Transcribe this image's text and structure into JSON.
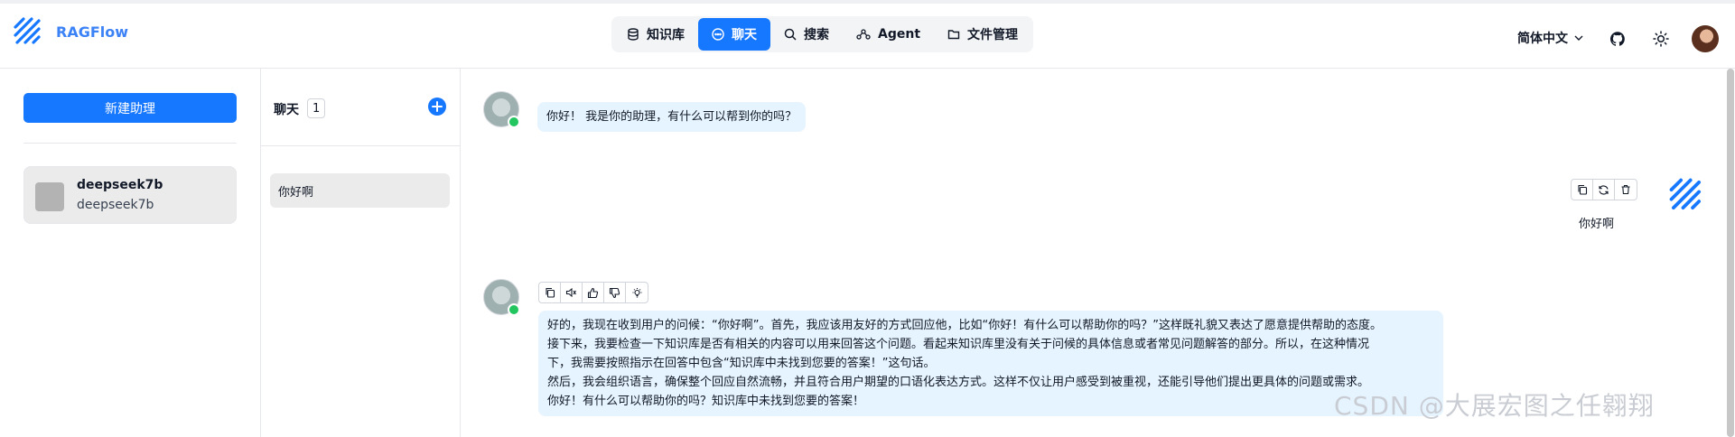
{
  "app": {
    "name": "RAGFlow"
  },
  "nav": [
    {
      "label": "知识库",
      "icon": "database-icon",
      "active": false
    },
    {
      "label": "聊天",
      "icon": "chat-icon",
      "active": true
    },
    {
      "label": "搜索",
      "icon": "search-icon",
      "active": false
    },
    {
      "label": "Agent",
      "icon": "agent-icon",
      "active": false
    },
    {
      "label": "文件管理",
      "icon": "folder-icon",
      "active": false
    }
  ],
  "header": {
    "language": "简体中文"
  },
  "assistants": {
    "new_button": "新建助理",
    "items": [
      {
        "name": "deepseek7b",
        "description": "deepseek7b"
      }
    ]
  },
  "conversations": {
    "title": "聊天",
    "count": "1",
    "items": [
      {
        "label": "你好啊"
      }
    ]
  },
  "messages": {
    "greeting": "你好！ 我是你的助理，有什么可以帮到你的吗？",
    "user": "你好啊",
    "answer_lines": [
      "好的，我现在收到用户的问候：“你好啊”。首先，我应该用友好的方式回应他，比如“你好！有什么可以帮助你的吗？”这样既礼貌又表达了愿意提供帮助的态度。",
      "接下来，我要检查一下知识库是否有相关的内容可以用来回答这个问题。看起来知识库里没有关于问候的具体信息或者常见问题解答的部分。所以，在这种情况",
      "下，我需要按照指示在回答中包含“知识库中未找到您要的答案！”这句话。",
      "然后，我会组织语言，确保整个回应自然流畅，并且符合用户期望的口语化表达方式。这样不仅让用户感受到被重视，还能引导他们提出更具体的问题或需求。",
      "你好！有什么可以帮助你的吗？知识库中未找到您要的答案！"
    ]
  },
  "watermark": "CSDN @大展宏图之任翱翔",
  "colors": {
    "primary": "#1677ff",
    "bubble": "#e6f4ff",
    "online": "#22c55e"
  }
}
